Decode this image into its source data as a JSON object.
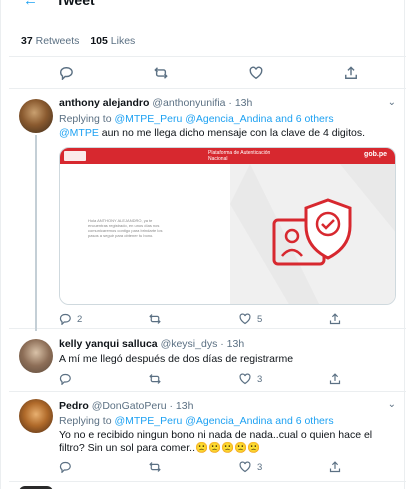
{
  "header": {
    "back_label": "←",
    "title": "Tweet"
  },
  "stats": {
    "retweets_count": "37",
    "retweets_label": "Retweets",
    "likes_count": "105",
    "likes_label": "Likes"
  },
  "tweets": [
    {
      "name": "anthony alejandro",
      "handle": "@anthonyunifia",
      "time": "· 13h",
      "replying_prefix": "Replying to",
      "replying_to": "@MTPE_Peru @Agencia_Andina and 6 others",
      "mention": "@MTPE",
      "text": "aun no me llega dicho mensaje con la clave de 4 digitos.",
      "media": {
        "bar_left": "RENIEC",
        "bar_center": "Plataforma de Autenticación Nacional",
        "bar_right": "gob.pe",
        "fine_print": "Hola ANTHONY ALEJANDRO, ya te encuentras registrado, en unos días nos comunicaremos contigo para brindarte los pasos a seguir para obtener tu bono."
      },
      "replies": "2",
      "retweets": "",
      "likes": "5"
    },
    {
      "name": "kelly yanqui salluca",
      "handle": "@keysi_dys",
      "time": "· 13h",
      "text": "A mí me llegó después de dos días de registrarme",
      "replies": "",
      "retweets": "",
      "likes": "3"
    },
    {
      "name": "Pedro",
      "handle": "@DonGatoPeru",
      "time": "· 13h",
      "replying_prefix": "Replying to",
      "replying_to": "@MTPE_Peru @Agencia_Andina and 6 others",
      "text_line1": "Yo no e recibido ningun bono ni nada de nada..cual o quien hace el",
      "text_line2": "filtro? Sin un sol para comer..🙁🙁🙁🙁🙁",
      "replies": "",
      "retweets": "",
      "likes": "3"
    }
  ],
  "colors": {
    "accent": "#1da1f2",
    "muted": "#5b7083",
    "border": "#ebeef0",
    "reniec_red": "#d7282f"
  },
  "icons": [
    "back-arrow-icon",
    "reply-icon",
    "retweet-icon",
    "like-icon",
    "share-icon",
    "more-chevron-icon",
    "shield-check-icon"
  ]
}
